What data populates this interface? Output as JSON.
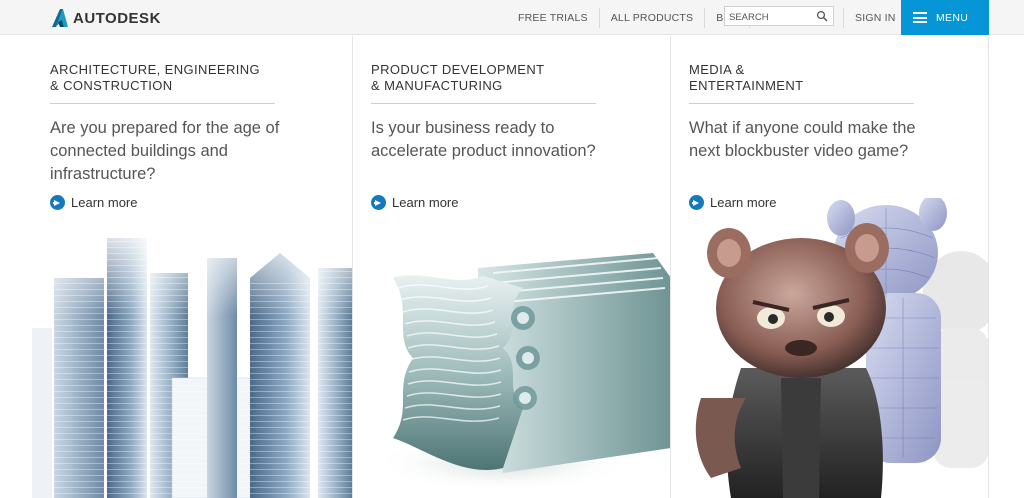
{
  "header": {
    "logo_text": "AUTODESK",
    "nav": [
      "FREE TRIALS",
      "ALL PRODUCTS",
      "BUY"
    ],
    "search_placeholder": "SEARCH",
    "sign_in": "SIGN IN",
    "menu": "MENU"
  },
  "panels": [
    {
      "title": "ARCHITECTURE, ENGINEERING\n& CONSTRUCTION",
      "question": "Are you prepared for the age of connected buildings and infrastructure?",
      "link": "Learn more"
    },
    {
      "title": "PRODUCT DEVELOPMENT\n& MANUFACTURING",
      "question": "Is your business ready to accelerate product innovation?",
      "link": "Learn more"
    },
    {
      "title": "MEDIA &\nENTERTAINMENT",
      "question": "What if anyone could make the next blockbuster video game?",
      "link": "Learn more"
    }
  ],
  "colors": {
    "menu_bg": "#0696d7",
    "link_icon": "#1479bd"
  },
  "icons": [
    "autodesk-logo-icon",
    "search-icon",
    "hamburger-icon",
    "arrow-right-circle-icon"
  ]
}
